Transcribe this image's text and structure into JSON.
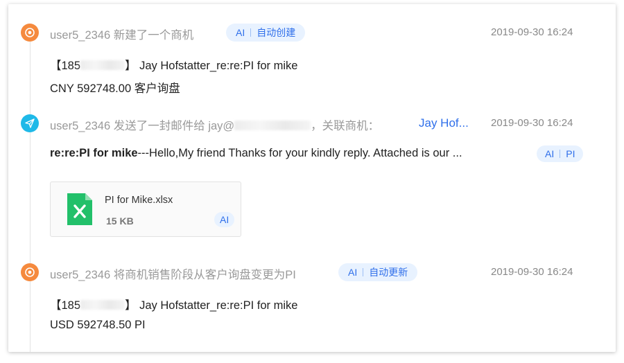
{
  "colors": {
    "accent": "#2f6fea",
    "orange_node": "#f58a3e",
    "cyan_node": "#1fb9e8",
    "tag_bg": "#e8f2ff"
  },
  "events": [
    {
      "icon": "target-icon",
      "actor_text": "user5_2346 新建了一个商机",
      "tag": {
        "ai": "AI",
        "label": "自动创建"
      },
      "time": "2019-09-30 16:24",
      "line1_prefix": "【185",
      "line1_suffix": "】 Jay Hofstatter_re:re:PI for mike",
      "line2": "CNY 592748.00    客户询盘"
    },
    {
      "icon": "paper-plane-icon",
      "actor_text_prefix": "user5_2346 发送了一封邮件给 jay@",
      "actor_text_suffix": "，关联商机：",
      "link": "Jay Hof...",
      "time": "2019-09-30 16:24",
      "subject": "re:re:PI for mike",
      "snippet": "---Hello,My friend Thanks for your kindly reply. Attached is our ...",
      "tag": {
        "ai": "AI",
        "label": "PI"
      },
      "attachment": {
        "name": "PI for Mike.xlsx",
        "size": "15 KB",
        "badge": "AI"
      }
    },
    {
      "icon": "target-icon",
      "actor_text": "user5_2346 将商机销售阶段从客户询盘变更为PI",
      "tag": {
        "ai": "AI",
        "label": "自动更新"
      },
      "time": "2019-09-30 16:24",
      "line1_prefix": "【185",
      "line1_suffix": "】 Jay Hofstatter_re:re:PI for mike",
      "line2": "USD 592748.50    PI"
    }
  ]
}
